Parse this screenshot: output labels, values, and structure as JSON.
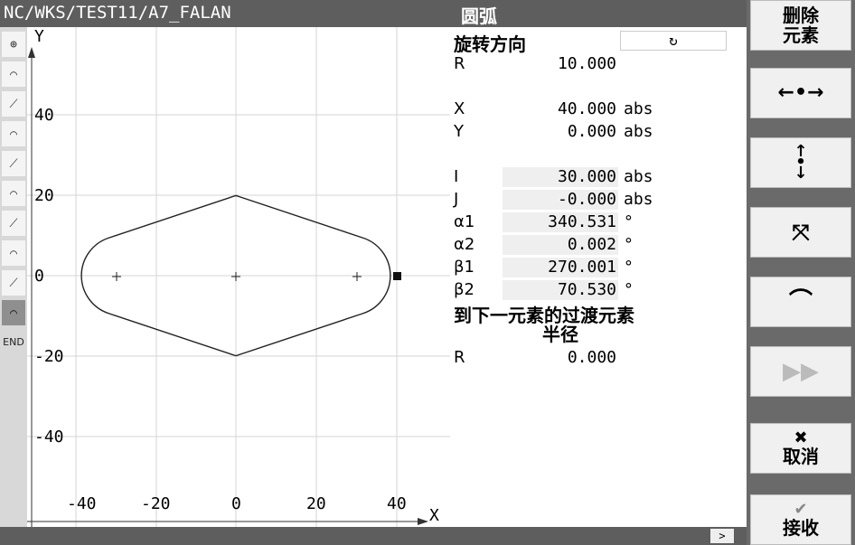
{
  "header": {
    "path": "NC/WKS/TEST11/A7_FALAN",
    "panel_title": "圆弧"
  },
  "toolbar": {
    "end_label": "END"
  },
  "graph": {
    "y_axis_label": "Y",
    "x_axis_label": "X",
    "y_ticks": [
      "40",
      "20",
      "0",
      "-20",
      "-40"
    ],
    "x_ticks": [
      "-40",
      "-20",
      "0",
      "20",
      "40"
    ]
  },
  "params": {
    "direction_label": "旋转方向",
    "direction_value": "↻",
    "r_label": "R",
    "r_value": "10.000",
    "x_label": "X",
    "x_value": "40.000",
    "x_unit": "abs",
    "y_label": "Y",
    "y_value": "0.000",
    "y_unit": "abs",
    "i_label": "I",
    "i_value": "30.000",
    "i_unit": "abs",
    "j_label": "J",
    "j_value": "-0.000",
    "j_unit": "abs",
    "a1_label": "α1",
    "a1_value": "340.531",
    "a1_unit": "°",
    "a2_label": "α2",
    "a2_value": "0.002",
    "a2_unit": "°",
    "b1_label": "β1",
    "b1_value": "270.001",
    "b1_unit": "°",
    "b2_label": "β2",
    "b2_value": "70.530",
    "b2_unit": "°",
    "transition_title": "到下一元素的过渡元素",
    "transition_type": "半径",
    "tr_label": "R",
    "tr_value": "0.000"
  },
  "softkeys": {
    "delete_line1": "删除",
    "delete_line2": "元素",
    "cancel": "取消",
    "accept": "接收"
  },
  "statusbar": {
    "scroll": ">"
  },
  "colors": {
    "header_bg": "#5e5e5e",
    "softkey_bg": "#f0f0f0",
    "selected_tool": "#8f8f8f"
  }
}
